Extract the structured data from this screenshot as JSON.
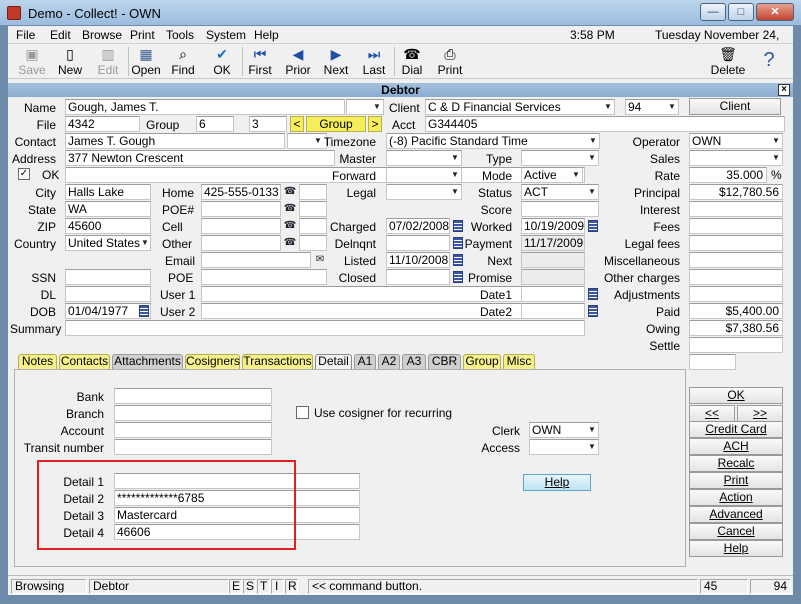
{
  "window": {
    "title": "Demo - Collect! - OWN"
  },
  "menu": {
    "items": [
      "File",
      "Edit",
      "Browse",
      "Print",
      "Tools",
      "System",
      "Help"
    ],
    "time": "3:58 PM",
    "date": "Tuesday November 24, 2009"
  },
  "toolbar": {
    "save": "Save",
    "new": "New",
    "edit": "Edit",
    "open": "Open",
    "find": "Find",
    "ok": "OK",
    "first": "First",
    "prior": "Prior",
    "next": "Next",
    "last": "Last",
    "dial": "Dial",
    "print": "Print",
    "delete": "Delete"
  },
  "form": {
    "title": "Debtor"
  },
  "debtor": {
    "labels": {
      "name": "Name",
      "file": "File",
      "group": "Group",
      "contact": "Contact",
      "address": "Address",
      "ok": "OK",
      "city": "City",
      "state": "State",
      "zip": "ZIP",
      "country": "Country",
      "ssn": "SSN",
      "dl": "DL",
      "dob": "DOB",
      "summary": "Summary",
      "home": "Home",
      "poe_num": "POE#",
      "cell": "Cell",
      "other": "Other",
      "email": "Email",
      "poe": "POE",
      "user1": "User 1",
      "user2": "User 2",
      "client": "Client",
      "acct": "Acct",
      "timezone": "Timezone",
      "master": "Master",
      "forward": "Forward",
      "legal": "Legal",
      "score": "Score",
      "charged": "Charged",
      "delnqnt": "Delnqnt",
      "listed": "Listed",
      "closed": "Closed",
      "type": "Type",
      "mode": "Mode",
      "status": "Status",
      "worked": "Worked",
      "payment": "Payment",
      "next": "Next",
      "promise": "Promise",
      "date1": "Date1",
      "date2": "Date2",
      "operator": "Operator",
      "sales": "Sales",
      "rate": "Rate",
      "principal": "Principal",
      "interest": "Interest",
      "fees": "Fees",
      "legal_fees": "Legal fees",
      "misc": "Miscellaneous",
      "other_charges": "Other charges",
      "adjustments": "Adjustments",
      "paid": "Paid",
      "owing": "Owing",
      "settle": "Settle"
    },
    "values": {
      "name": "Gough, James T.",
      "file": "4342",
      "group_a": "6",
      "group_b": "3",
      "contact": "James T. Gough",
      "address": "377 Newton Crescent",
      "city": "Halls Lake",
      "state": "WA",
      "zip": "45600",
      "country": "United States",
      "dob": "01/04/1977",
      "home": "425-555-0133",
      "client": "C & D Financial Services",
      "client_num": "94",
      "acct": "G344405",
      "timezone": "(-8) Pacific Standard Time",
      "charged": "07/02/2008",
      "listed": "11/10/2008",
      "mode": "Active",
      "status": "ACT",
      "worked": "10/19/2009",
      "payment": "11/17/2009",
      "operator": "OWN",
      "rate": "35.000",
      "rate_unit": "%",
      "principal": "$12,780.56",
      "paid": "$5,400.00",
      "owing": "$7,380.56"
    },
    "group_button": "Group",
    "group_prev": "<",
    "group_next": ">",
    "client_button": "Client",
    "check_mark": "✓"
  },
  "tabs": [
    "Notes",
    "Contacts",
    "Attachments",
    "Cosigners",
    "Transactions",
    "Detail",
    "A1",
    "A2",
    "A3",
    "CBR",
    "Group",
    "Misc"
  ],
  "detail": {
    "labels": {
      "bank": "Bank",
      "branch": "Branch",
      "account": "Account",
      "transit": "Transit number",
      "cosigner": "Use cosigner for recurring",
      "clerk": "Clerk",
      "access": "Access",
      "detail1": "Detail 1",
      "detail2": "Detail 2",
      "detail3": "Detail 3",
      "detail4": "Detail 4"
    },
    "values": {
      "clerk": "OWN",
      "detail1": "",
      "detail2": "*************6785",
      "detail3": "Mastercard",
      "detail4": "46606"
    },
    "help_button": "Help"
  },
  "sidebar": {
    "ok": "OK",
    "prev": "<<",
    "next": ">>",
    "buttons": [
      "Credit Card",
      "ACH",
      "Recalc",
      "Print",
      "Action",
      "Advanced",
      "Cancel",
      "Help"
    ]
  },
  "statusbar": {
    "mode": "Browsing",
    "form": "Debtor",
    "keys": [
      "E",
      "S",
      "T",
      "I",
      "R"
    ],
    "message": "<< command button.",
    "pos": "45",
    "count": "94"
  }
}
